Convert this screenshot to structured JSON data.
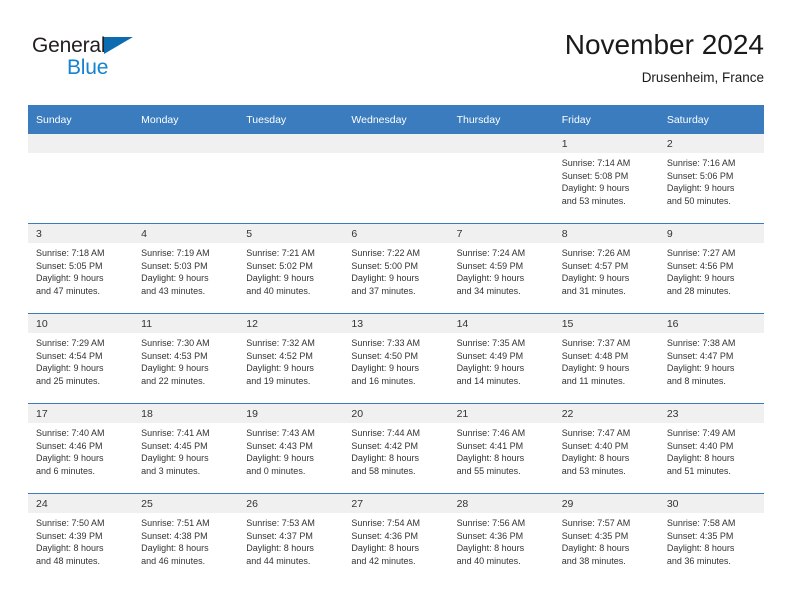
{
  "brand": {
    "name_part1": "General",
    "name_part2": "Blue",
    "triangle_icon": "triangle-icon",
    "color_dark": "#231f20",
    "color_blue": "#1683d0"
  },
  "header": {
    "title": "November 2024",
    "subtitle": "Drusenheim, France"
  },
  "theme": {
    "header_band": "#3b7cbf",
    "daynum_strip": "#f0f0f0",
    "text": "#333333"
  },
  "weekdays": [
    "Sunday",
    "Monday",
    "Tuesday",
    "Wednesday",
    "Thursday",
    "Friday",
    "Saturday"
  ],
  "weeks": [
    [
      {
        "day": "",
        "sunrise": "",
        "sunset": "",
        "daylight1": "",
        "daylight2": "",
        "empty": true
      },
      {
        "day": "",
        "sunrise": "",
        "sunset": "",
        "daylight1": "",
        "daylight2": "",
        "empty": true
      },
      {
        "day": "",
        "sunrise": "",
        "sunset": "",
        "daylight1": "",
        "daylight2": "",
        "empty": true
      },
      {
        "day": "",
        "sunrise": "",
        "sunset": "",
        "daylight1": "",
        "daylight2": "",
        "empty": true
      },
      {
        "day": "",
        "sunrise": "",
        "sunset": "",
        "daylight1": "",
        "daylight2": "",
        "empty": true
      },
      {
        "day": "1",
        "sunrise": "Sunrise: 7:14 AM",
        "sunset": "Sunset: 5:08 PM",
        "daylight1": "Daylight: 9 hours",
        "daylight2": "and 53 minutes.",
        "empty": false
      },
      {
        "day": "2",
        "sunrise": "Sunrise: 7:16 AM",
        "sunset": "Sunset: 5:06 PM",
        "daylight1": "Daylight: 9 hours",
        "daylight2": "and 50 minutes.",
        "empty": false
      }
    ],
    [
      {
        "day": "3",
        "sunrise": "Sunrise: 7:18 AM",
        "sunset": "Sunset: 5:05 PM",
        "daylight1": "Daylight: 9 hours",
        "daylight2": "and 47 minutes.",
        "empty": false
      },
      {
        "day": "4",
        "sunrise": "Sunrise: 7:19 AM",
        "sunset": "Sunset: 5:03 PM",
        "daylight1": "Daylight: 9 hours",
        "daylight2": "and 43 minutes.",
        "empty": false
      },
      {
        "day": "5",
        "sunrise": "Sunrise: 7:21 AM",
        "sunset": "Sunset: 5:02 PM",
        "daylight1": "Daylight: 9 hours",
        "daylight2": "and 40 minutes.",
        "empty": false
      },
      {
        "day": "6",
        "sunrise": "Sunrise: 7:22 AM",
        "sunset": "Sunset: 5:00 PM",
        "daylight1": "Daylight: 9 hours",
        "daylight2": "and 37 minutes.",
        "empty": false
      },
      {
        "day": "7",
        "sunrise": "Sunrise: 7:24 AM",
        "sunset": "Sunset: 4:59 PM",
        "daylight1": "Daylight: 9 hours",
        "daylight2": "and 34 minutes.",
        "empty": false
      },
      {
        "day": "8",
        "sunrise": "Sunrise: 7:26 AM",
        "sunset": "Sunset: 4:57 PM",
        "daylight1": "Daylight: 9 hours",
        "daylight2": "and 31 minutes.",
        "empty": false
      },
      {
        "day": "9",
        "sunrise": "Sunrise: 7:27 AM",
        "sunset": "Sunset: 4:56 PM",
        "daylight1": "Daylight: 9 hours",
        "daylight2": "and 28 minutes.",
        "empty": false
      }
    ],
    [
      {
        "day": "10",
        "sunrise": "Sunrise: 7:29 AM",
        "sunset": "Sunset: 4:54 PM",
        "daylight1": "Daylight: 9 hours",
        "daylight2": "and 25 minutes.",
        "empty": false
      },
      {
        "day": "11",
        "sunrise": "Sunrise: 7:30 AM",
        "sunset": "Sunset: 4:53 PM",
        "daylight1": "Daylight: 9 hours",
        "daylight2": "and 22 minutes.",
        "empty": false
      },
      {
        "day": "12",
        "sunrise": "Sunrise: 7:32 AM",
        "sunset": "Sunset: 4:52 PM",
        "daylight1": "Daylight: 9 hours",
        "daylight2": "and 19 minutes.",
        "empty": false
      },
      {
        "day": "13",
        "sunrise": "Sunrise: 7:33 AM",
        "sunset": "Sunset: 4:50 PM",
        "daylight1": "Daylight: 9 hours",
        "daylight2": "and 16 minutes.",
        "empty": false
      },
      {
        "day": "14",
        "sunrise": "Sunrise: 7:35 AM",
        "sunset": "Sunset: 4:49 PM",
        "daylight1": "Daylight: 9 hours",
        "daylight2": "and 14 minutes.",
        "empty": false
      },
      {
        "day": "15",
        "sunrise": "Sunrise: 7:37 AM",
        "sunset": "Sunset: 4:48 PM",
        "daylight1": "Daylight: 9 hours",
        "daylight2": "and 11 minutes.",
        "empty": false
      },
      {
        "day": "16",
        "sunrise": "Sunrise: 7:38 AM",
        "sunset": "Sunset: 4:47 PM",
        "daylight1": "Daylight: 9 hours",
        "daylight2": "and 8 minutes.",
        "empty": false
      }
    ],
    [
      {
        "day": "17",
        "sunrise": "Sunrise: 7:40 AM",
        "sunset": "Sunset: 4:46 PM",
        "daylight1": "Daylight: 9 hours",
        "daylight2": "and 6 minutes.",
        "empty": false
      },
      {
        "day": "18",
        "sunrise": "Sunrise: 7:41 AM",
        "sunset": "Sunset: 4:45 PM",
        "daylight1": "Daylight: 9 hours",
        "daylight2": "and 3 minutes.",
        "empty": false
      },
      {
        "day": "19",
        "sunrise": "Sunrise: 7:43 AM",
        "sunset": "Sunset: 4:43 PM",
        "daylight1": "Daylight: 9 hours",
        "daylight2": "and 0 minutes.",
        "empty": false
      },
      {
        "day": "20",
        "sunrise": "Sunrise: 7:44 AM",
        "sunset": "Sunset: 4:42 PM",
        "daylight1": "Daylight: 8 hours",
        "daylight2": "and 58 minutes.",
        "empty": false
      },
      {
        "day": "21",
        "sunrise": "Sunrise: 7:46 AM",
        "sunset": "Sunset: 4:41 PM",
        "daylight1": "Daylight: 8 hours",
        "daylight2": "and 55 minutes.",
        "empty": false
      },
      {
        "day": "22",
        "sunrise": "Sunrise: 7:47 AM",
        "sunset": "Sunset: 4:40 PM",
        "daylight1": "Daylight: 8 hours",
        "daylight2": "and 53 minutes.",
        "empty": false
      },
      {
        "day": "23",
        "sunrise": "Sunrise: 7:49 AM",
        "sunset": "Sunset: 4:40 PM",
        "daylight1": "Daylight: 8 hours",
        "daylight2": "and 51 minutes.",
        "empty": false
      }
    ],
    [
      {
        "day": "24",
        "sunrise": "Sunrise: 7:50 AM",
        "sunset": "Sunset: 4:39 PM",
        "daylight1": "Daylight: 8 hours",
        "daylight2": "and 48 minutes.",
        "empty": false
      },
      {
        "day": "25",
        "sunrise": "Sunrise: 7:51 AM",
        "sunset": "Sunset: 4:38 PM",
        "daylight1": "Daylight: 8 hours",
        "daylight2": "and 46 minutes.",
        "empty": false
      },
      {
        "day": "26",
        "sunrise": "Sunrise: 7:53 AM",
        "sunset": "Sunset: 4:37 PM",
        "daylight1": "Daylight: 8 hours",
        "daylight2": "and 44 minutes.",
        "empty": false
      },
      {
        "day": "27",
        "sunrise": "Sunrise: 7:54 AM",
        "sunset": "Sunset: 4:36 PM",
        "daylight1": "Daylight: 8 hours",
        "daylight2": "and 42 minutes.",
        "empty": false
      },
      {
        "day": "28",
        "sunrise": "Sunrise: 7:56 AM",
        "sunset": "Sunset: 4:36 PM",
        "daylight1": "Daylight: 8 hours",
        "daylight2": "and 40 minutes.",
        "empty": false
      },
      {
        "day": "29",
        "sunrise": "Sunrise: 7:57 AM",
        "sunset": "Sunset: 4:35 PM",
        "daylight1": "Daylight: 8 hours",
        "daylight2": "and 38 minutes.",
        "empty": false
      },
      {
        "day": "30",
        "sunrise": "Sunrise: 7:58 AM",
        "sunset": "Sunset: 4:35 PM",
        "daylight1": "Daylight: 8 hours",
        "daylight2": "and 36 minutes.",
        "empty": false
      }
    ]
  ]
}
